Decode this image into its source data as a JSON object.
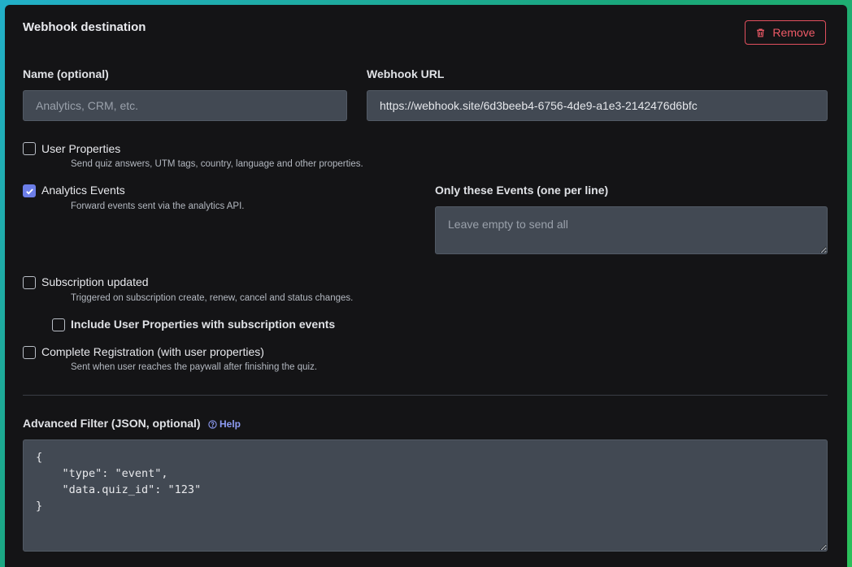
{
  "section": {
    "title": "Webhook destination",
    "remove_label": "Remove"
  },
  "name_field": {
    "label": "Name (optional)",
    "value": "",
    "placeholder": "Analytics, CRM, etc."
  },
  "url_field": {
    "label": "Webhook URL",
    "value": "https://webhook.site/6d3beeb4-6756-4de9-a1e3-2142476d6bfc"
  },
  "options": {
    "user_properties": {
      "label": "User Properties",
      "desc": "Send quiz answers, UTM tags, country, language and other properties.",
      "checked": false
    },
    "analytics_events": {
      "label": "Analytics Events",
      "desc": "Forward events sent via the analytics API.",
      "checked": true
    },
    "subscription_updated": {
      "label": "Subscription updated",
      "desc": "Triggered on subscription create, renew, cancel and status changes.",
      "checked": false
    },
    "include_user_properties": {
      "label": "Include User Properties with subscription events",
      "checked": false
    },
    "complete_registration": {
      "label": "Complete Registration (with user properties)",
      "desc": "Sent when user reaches the paywall after finishing the quiz.",
      "checked": false
    }
  },
  "events_filter": {
    "label": "Only these Events (one per line)",
    "value": "",
    "placeholder": "Leave empty to send all"
  },
  "advanced_filter": {
    "label": "Advanced Filter (JSON, optional)",
    "help_label": "Help",
    "value": "{\n    \"type\": \"event\",\n    \"data.quiz_id\": \"123\"\n}"
  },
  "icons": {
    "remove": "trash-icon",
    "help": "question-circle-icon",
    "check": "check-icon"
  },
  "colors": {
    "danger": "#ef5a67",
    "accent": "#6c7ee8",
    "link": "#8e9cf4",
    "panel": "#141416",
    "field": "#424953"
  }
}
